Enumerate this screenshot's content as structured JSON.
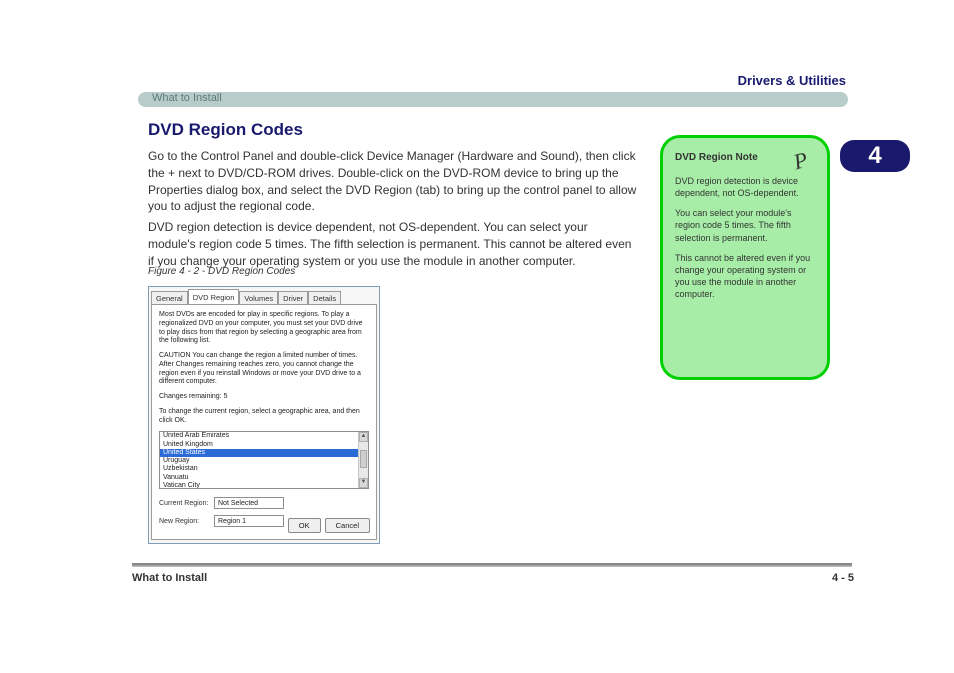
{
  "header": {
    "chapter": "Drivers & Utilities",
    "section": "What to Install"
  },
  "badge": "4",
  "main": {
    "title": "DVD Region Codes",
    "intro": "Go to the Control Panel and double-click Device Manager (Hardware and Sound), then click the + next to DVD/CD-ROM drives. Double-click on the DVD-ROM device to bring up the Properties dialog box, and select the DVD Region (tab) to bring up the control panel to allow you to adjust the regional code.",
    "intro2": "DVD region detection is device dependent, not OS-dependent. You can select your module's region code 5 times. The fifth selection is permanent. This cannot be altered even if you change your operating system or you use the module in another computer.",
    "figure_label": "Figure 4 - 2 - DVD Region Codes"
  },
  "dialog": {
    "tabs": [
      "General",
      "DVD Region",
      "Volumes",
      "Driver",
      "Details"
    ],
    "active_tab": "DVD Region",
    "body_p1": "Most DVDs are encoded for play in specific regions. To play a regionalized DVD on your computer, you must set your DVD drive to play discs from that region by selecting a geographic area from the following list.",
    "body_p2": "CAUTION   You can change the region a limited number of times. After Changes remaining reaches zero, you cannot change the region even if you reinstall Windows or move your DVD drive to a different computer.",
    "changes_remaining_label": "Changes remaining: 5",
    "instruction": "To change the current region, select a geographic area, and then click OK.",
    "list_items": [
      "United Arab Emirates",
      "United Kingdom",
      "United States",
      "Uruguay",
      "Uzbekistan",
      "Vanuatu",
      "Vatican City"
    ],
    "selected_item": "United States",
    "current_region_label": "Current Region:",
    "current_region_value": "Not Selected",
    "new_region_label": "New Region:",
    "new_region_value": "Region 1",
    "ok": "OK",
    "cancel": "Cancel"
  },
  "note": {
    "title": "DVD Region Note",
    "p1": "DVD region detection is device dependent, not OS-dependent.",
    "p2": "You can select your module's region code 5 times. The fifth selection is permanent.",
    "p3": "This cannot be altered even if you change your operating system or you use the module in another computer."
  },
  "pen_glyph": "P",
  "footer": {
    "left": "What to Install",
    "right": "4 - 5"
  }
}
